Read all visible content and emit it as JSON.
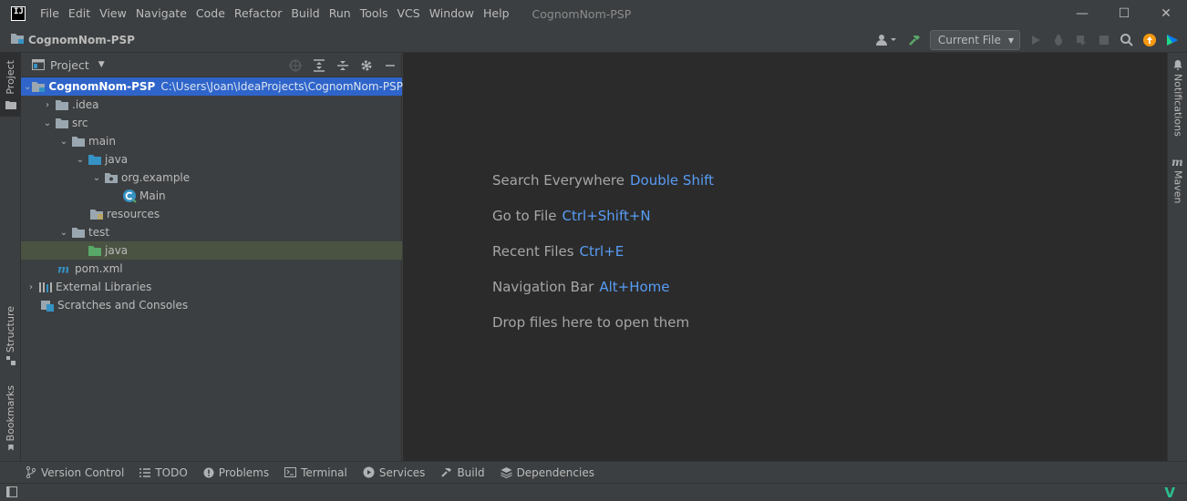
{
  "window": {
    "title": "CognomNom-PSP",
    "minimize": "—",
    "maximize": "☐",
    "close": "✕"
  },
  "menu": [
    "File",
    "Edit",
    "View",
    "Navigate",
    "Code",
    "Refactor",
    "Build",
    "Run",
    "Tools",
    "VCS",
    "Window",
    "Help"
  ],
  "navbar": {
    "project_name": "CognomNom-PSP",
    "run_config": "Current File"
  },
  "left_stripe": {
    "project": "Project",
    "structure": "Structure",
    "bookmarks": "Bookmarks"
  },
  "right_stripe": {
    "notifications": "Notifications",
    "maven": "Maven"
  },
  "project_panel": {
    "title": "Project"
  },
  "tree": {
    "root_name": "CognomNom-PSP",
    "root_path": "C:\\Users\\Joan\\IdeaProjects\\CognomNom-PSP",
    "idea": ".idea",
    "src": "src",
    "main": "main",
    "java_main": "java",
    "package": "org.example",
    "main_class": "Main",
    "resources": "resources",
    "test": "test",
    "java_test": "java",
    "pom": "pom.xml",
    "ext_libs": "External Libraries",
    "scratches": "Scratches and Consoles"
  },
  "editor_hints": [
    {
      "label": "Search Everywhere",
      "key": "Double Shift"
    },
    {
      "label": "Go to File",
      "key": "Ctrl+Shift+N"
    },
    {
      "label": "Recent Files",
      "key": "Ctrl+E"
    },
    {
      "label": "Navigation Bar",
      "key": "Alt+Home"
    },
    {
      "label": "Drop files here to open them",
      "key": ""
    }
  ],
  "bottom_tools": [
    "Version Control",
    "TODO",
    "Problems",
    "Terminal",
    "Services",
    "Build",
    "Dependencies"
  ],
  "status": {
    "brand_mark": "V"
  },
  "colors": {
    "accent_selection": "#2f65ca",
    "link_key": "#589df6",
    "test_root": "#4a5342"
  }
}
